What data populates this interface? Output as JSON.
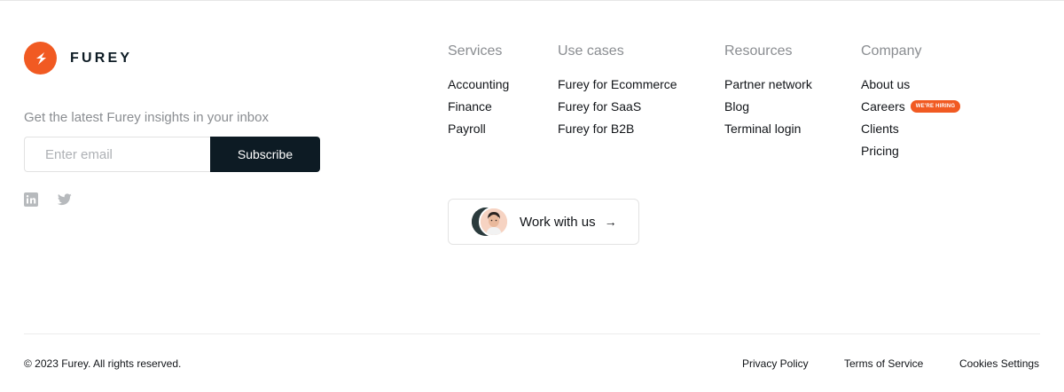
{
  "brand": {
    "name": "FUREY",
    "accent_color": "#f15a22",
    "dark_color": "#0d1b24",
    "logo_icon": "furey-logo-icon"
  },
  "newsletter": {
    "label": "Get the latest Furey insights in your inbox",
    "placeholder": "Enter email",
    "value": "",
    "button_label": "Subscribe"
  },
  "socials": [
    {
      "icon": "linkedin-icon"
    },
    {
      "icon": "twitter-icon"
    }
  ],
  "columns": {
    "services": {
      "title": "Services",
      "links": [
        "Accounting",
        "Finance",
        "Payroll"
      ]
    },
    "use_cases": {
      "title": "Use cases",
      "links": [
        "Furey for Ecommerce",
        "Furey for SaaS",
        "Furey for B2B"
      ]
    },
    "resources": {
      "title": "Resources",
      "links": [
        "Partner network",
        "Blog",
        "Terminal login"
      ]
    },
    "company": {
      "title": "Company",
      "links": [
        "About us",
        "Careers",
        "Clients",
        "Pricing"
      ],
      "careers_badge": "WE'RE HIRING"
    }
  },
  "work_with_us": {
    "label": "Work with us",
    "arrow": "→"
  },
  "footer": {
    "copyright": "© 2023 Furey. All rights reserved.",
    "links": [
      "Privacy Policy",
      "Terms of Service",
      "Cookies Settings"
    ]
  }
}
